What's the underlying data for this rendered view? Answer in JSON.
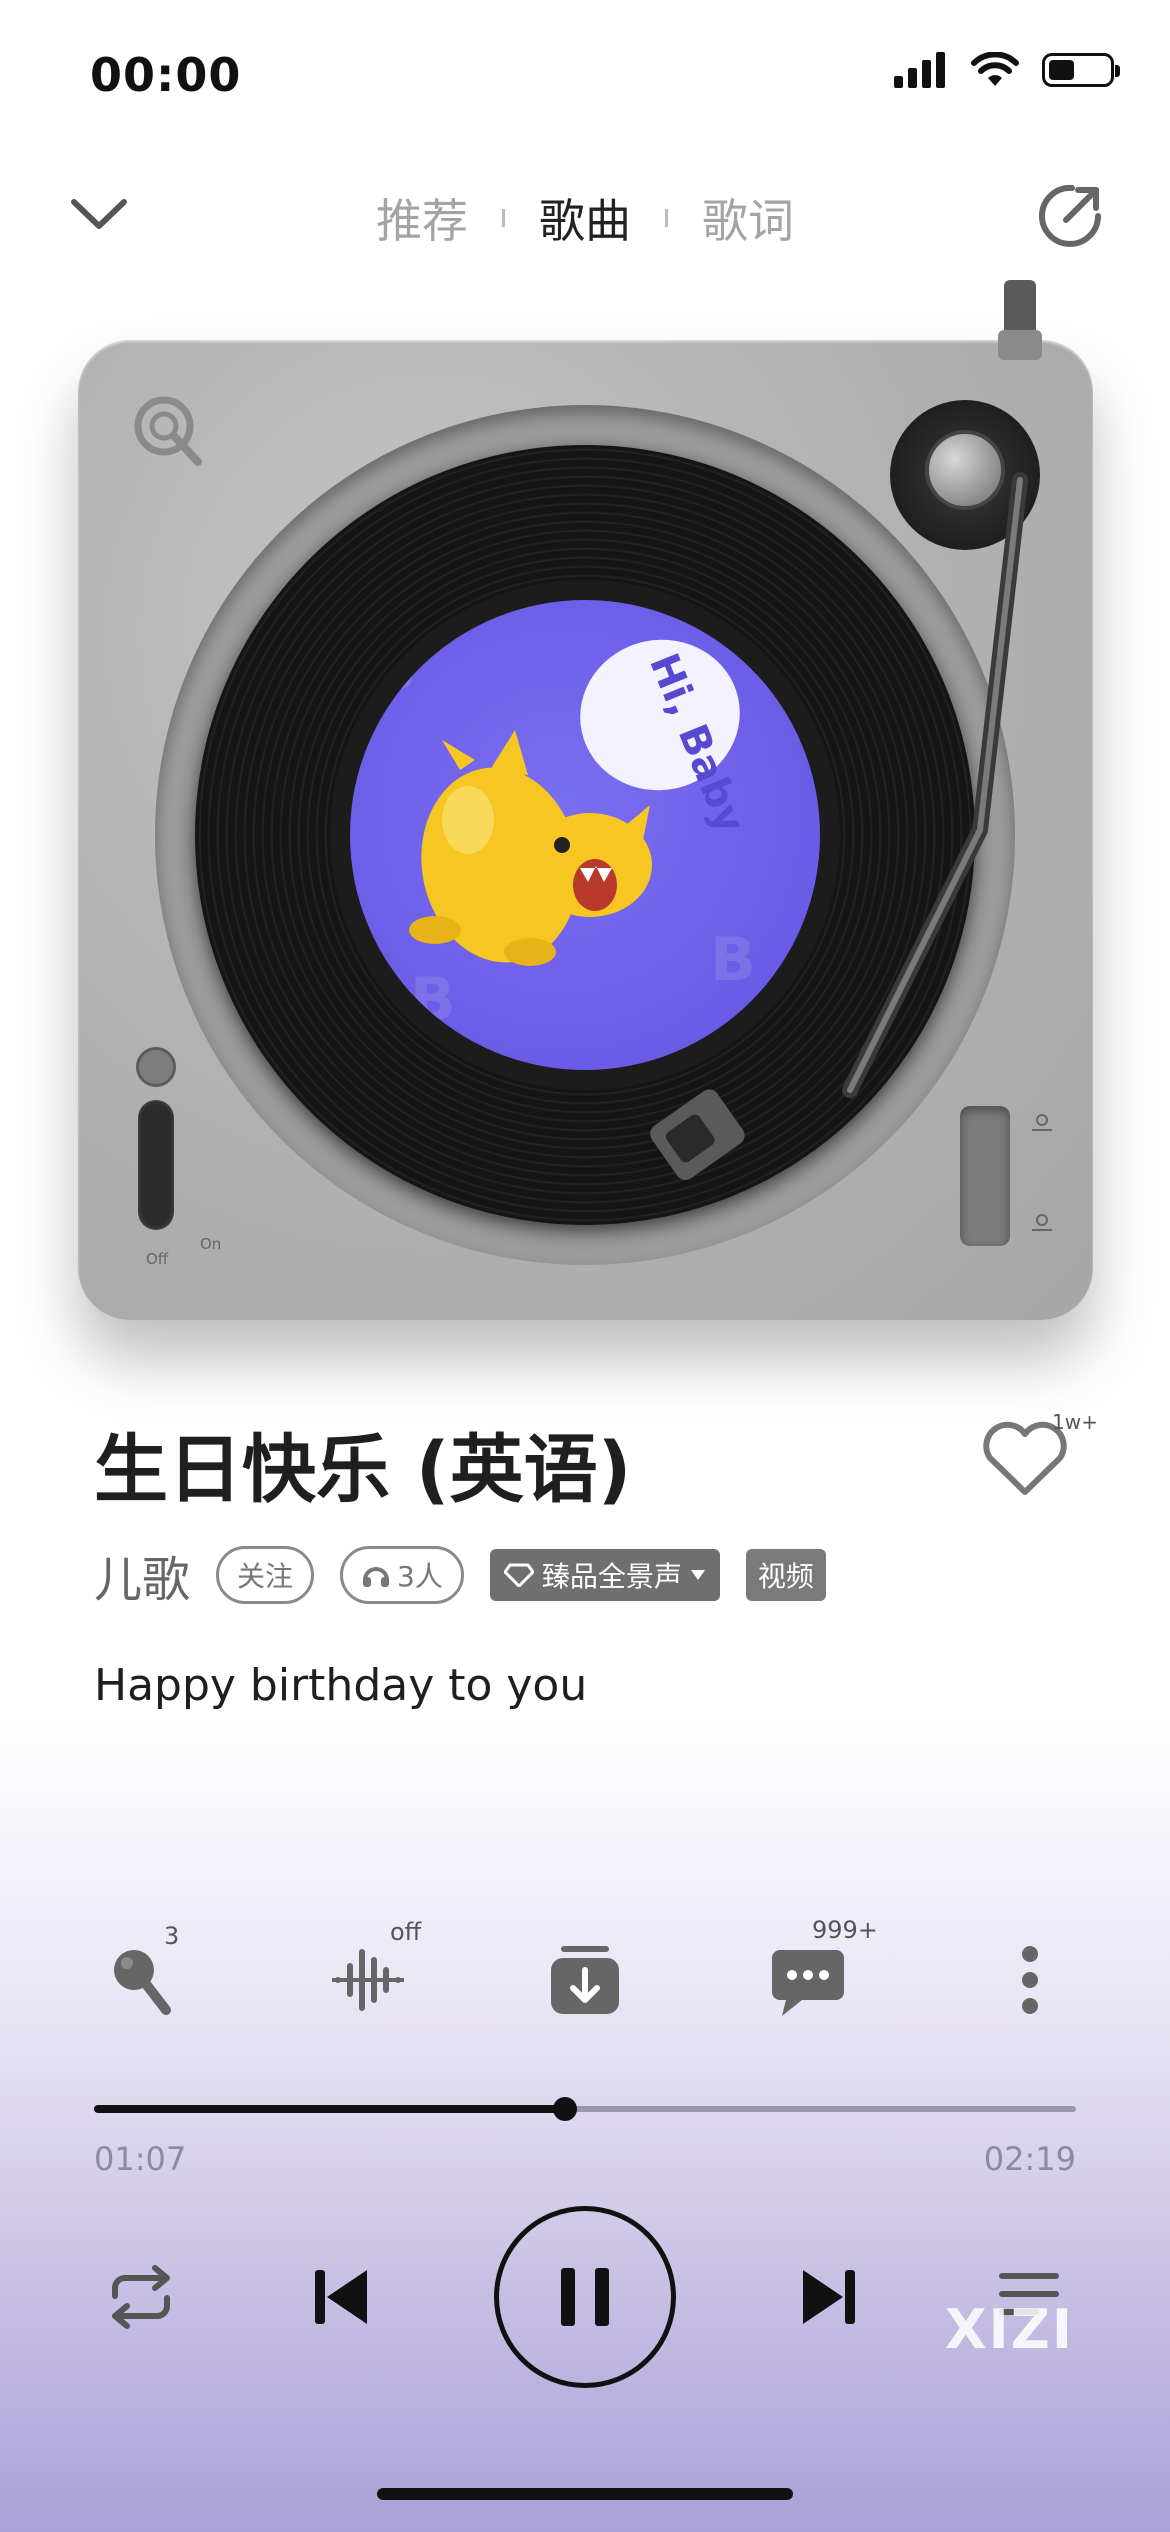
{
  "status_bar": {
    "time": "00:00",
    "battery_level": 0.38
  },
  "nav": {
    "tabs": [
      "推荐",
      "歌曲",
      "歌词"
    ],
    "active_tab": "歌曲"
  },
  "record": {
    "label_text": "Hi, Baby",
    "switch_left_off": "Off",
    "switch_left_on": "On"
  },
  "song": {
    "title": "生日快乐 (英语)",
    "artist": "儿歌",
    "follow_label": "关注",
    "listeners_label": "3人",
    "quality_label": "臻品全景声",
    "video_label": "视频",
    "like_count": "1w+",
    "lyric": "Happy birthday to you"
  },
  "actions": {
    "karaoke_badge": "3",
    "effect_badge": "off",
    "comments_badge": "999+"
  },
  "progress": {
    "current": "01:07",
    "total": "02:19",
    "fraction": 0.48
  },
  "watermark": "XIZI",
  "colors": {
    "accent": "#6a5ce6",
    "dark": "#111111"
  }
}
